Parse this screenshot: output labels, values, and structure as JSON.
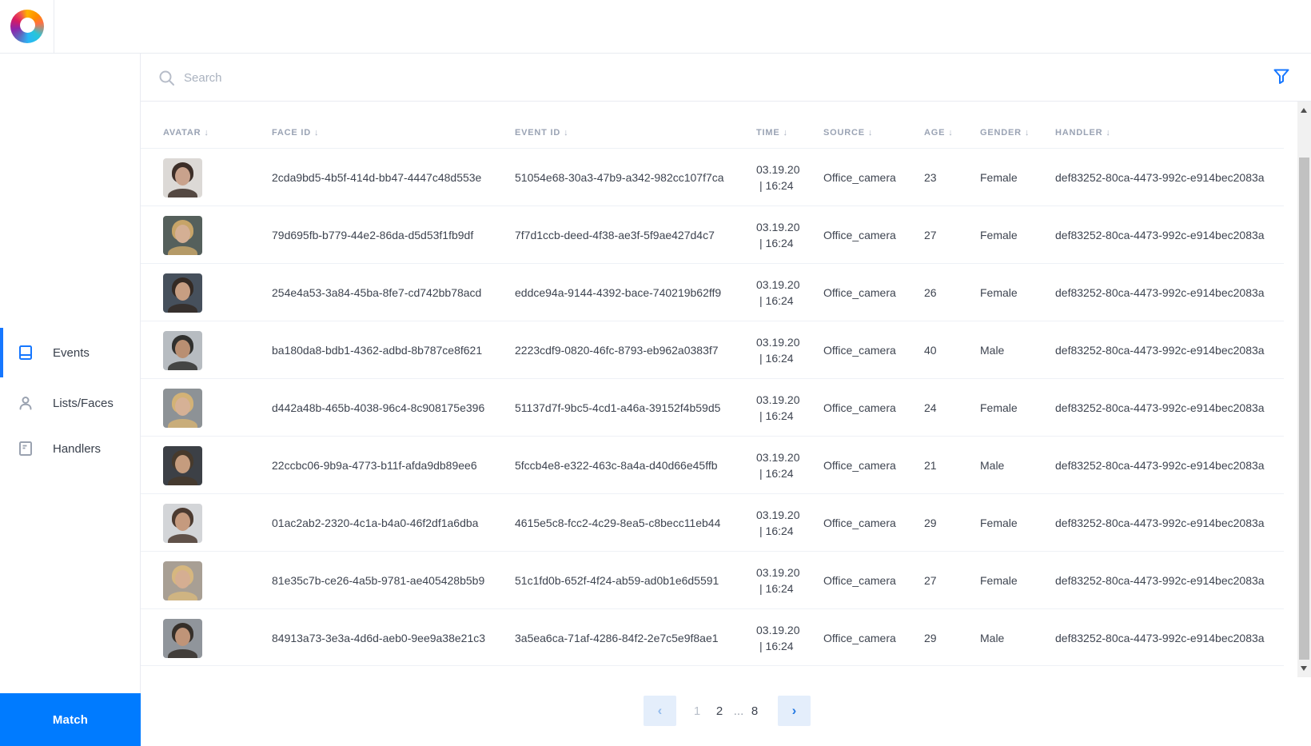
{
  "icons": {
    "sort_down": "↓",
    "chevron_left": "‹",
    "chevron_right": "›"
  },
  "colors": {
    "accent": "#1677ff",
    "match_button": "#007bff",
    "pagination_button_bg": "#e4eefb",
    "header_text": "#9aa3b4",
    "cell_text": "#3e4450"
  },
  "sidebar": {
    "items": [
      {
        "label": "Events",
        "active": true
      },
      {
        "label": "Lists/Faces",
        "active": false
      },
      {
        "label": "Handlers",
        "active": false
      }
    ],
    "match_label": "Match"
  },
  "search": {
    "placeholder": "Search"
  },
  "table": {
    "columns": [
      "AVATAR",
      "FACE ID",
      "EVENT ID",
      "TIME",
      "SOURCE",
      "AGE",
      "GENDER",
      "HANDLER"
    ],
    "rows": [
      {
        "avatar": {
          "bg": "#dcd9d6",
          "hair": "#3c2e28",
          "skin": "#c9a28c"
        },
        "face_id": "2cda9bd5-4b5f-414d-bb47-4447c48d553e",
        "event_id": "51054e68-30a3-47b9-a342-982cc107f7ca",
        "time_date": "03.19.20",
        "time_clock": "| 16:24",
        "source": "Office_camera",
        "age": "23",
        "gender": "Female",
        "handler": "def83252-80ca-4473-992c-e914bec2083a"
      },
      {
        "avatar": {
          "bg": "#55605c",
          "hair": "#c7a468",
          "skin": "#d4af94"
        },
        "face_id": "79d695fb-b779-44e2-86da-d5d53f1fb9df",
        "event_id": "7f7d1ccb-deed-4f38-ae3f-5f9ae427d4c7",
        "time_date": "03.19.20",
        "time_clock": "| 16:24",
        "source": "Office_camera",
        "age": "27",
        "gender": "Female",
        "handler": "def83252-80ca-4473-992c-e914bec2083a"
      },
      {
        "avatar": {
          "bg": "#46505c",
          "hair": "#342a24",
          "skin": "#c79e82"
        },
        "face_id": "254e4a53-3a84-45ba-8fe7-cd742bb78acd",
        "event_id": "eddce94a-9144-4392-bace-740219b62ff9",
        "time_date": "03.19.20",
        "time_clock": "| 16:24",
        "source": "Office_camera",
        "age": "26",
        "gender": "Female",
        "handler": "def83252-80ca-4473-992c-e914bec2083a"
      },
      {
        "avatar": {
          "bg": "#b7bcc1",
          "hair": "#30302e",
          "skin": "#b98f72"
        },
        "face_id": "ba180da8-bdb1-4362-adbd-8b787ce8f621",
        "event_id": "2223cdf9-0820-46fc-8793-eb962a0383f7",
        "time_date": "03.19.20",
        "time_clock": "| 16:24",
        "source": "Office_camera",
        "age": "40",
        "gender": "Male",
        "handler": "def83252-80ca-4473-992c-e914bec2083a"
      },
      {
        "avatar": {
          "bg": "#8d9296",
          "hair": "#d3b276",
          "skin": "#d6b196"
        },
        "face_id": "d442a48b-465b-4038-96c4-8c908175e396",
        "event_id": "51137d7f-9bc5-4cd1-a46a-39152f4b59d5",
        "time_date": "03.19.20",
        "time_clock": "| 16:24",
        "source": "Office_camera",
        "age": "24",
        "gender": "Female",
        "handler": "def83252-80ca-4473-992c-e914bec2083a"
      },
      {
        "avatar": {
          "bg": "#3c4046",
          "hair": "#473a2c",
          "skin": "#c59c7e"
        },
        "face_id": "22ccbc06-9b9a-4773-b11f-afda9db89ee6",
        "event_id": "5fccb4e8-e322-463c-8a4a-d40d66e45ffb",
        "time_date": "03.19.20",
        "time_clock": "| 16:24",
        "source": "Office_camera",
        "age": "21",
        "gender": "Male",
        "handler": "def83252-80ca-4473-992c-e914bec2083a"
      },
      {
        "avatar": {
          "bg": "#d3d5d8",
          "hair": "#4b3a30",
          "skin": "#c59a7e"
        },
        "face_id": "01ac2ab2-2320-4c1a-b4a0-46f2df1a6dba",
        "event_id": "4615e5c8-fcc2-4c29-8ea5-c8becc11eb44",
        "time_date": "03.19.20",
        "time_clock": "| 16:24",
        "source": "Office_camera",
        "age": "29",
        "gender": "Female",
        "handler": "def83252-80ca-4473-992c-e914bec2083a"
      },
      {
        "avatar": {
          "bg": "#a89f94",
          "hair": "#d6b77f",
          "skin": "#d5ae92"
        },
        "face_id": "81e35c7b-ce26-4a5b-9781-ae405428b5b9",
        "event_id": "51c1fd0b-652f-4f24-ab59-ad0b1e6d5591",
        "time_date": "03.19.20",
        "time_clock": "| 16:24",
        "source": "Office_camera",
        "age": "27",
        "gender": "Female",
        "handler": "def83252-80ca-4473-992c-e914bec2083a"
      },
      {
        "avatar": {
          "bg": "#90959b",
          "hair": "#352f29",
          "skin": "#bf9478"
        },
        "face_id": "84913a73-3e3a-4d6d-aeb0-9ee9a38e21c3",
        "event_id": "3a5ea6ca-71af-4286-84f2-2e7c5e9f8ae1",
        "time_date": "03.19.20",
        "time_clock": "| 16:24",
        "source": "Office_camera",
        "age": "29",
        "gender": "Male",
        "handler": "def83252-80ca-4473-992c-e914bec2083a"
      }
    ]
  },
  "pagination": {
    "pages": [
      "1",
      "2",
      "...",
      "8"
    ]
  }
}
